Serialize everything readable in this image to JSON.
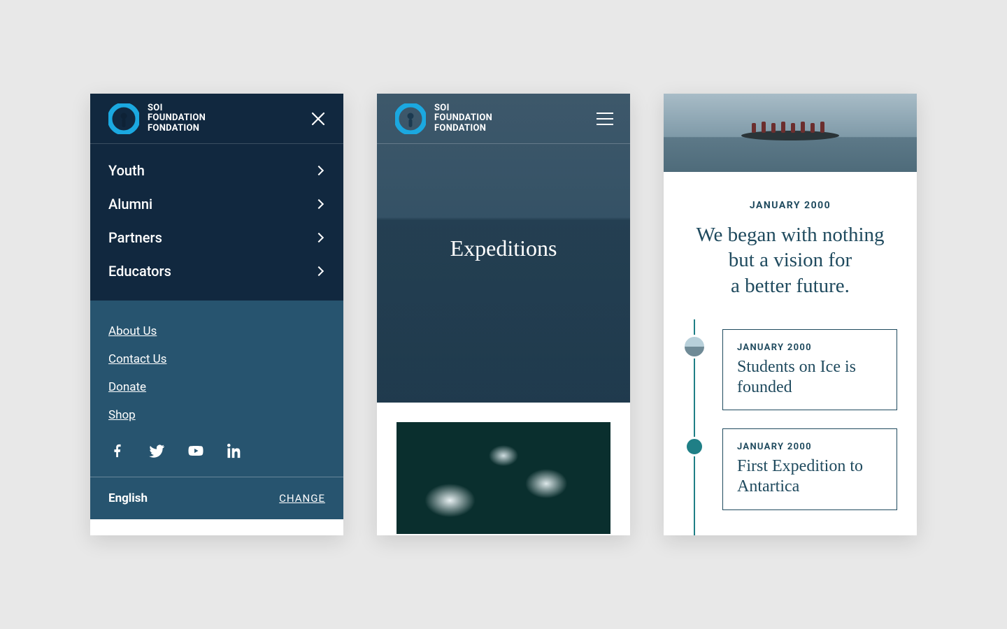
{
  "brand": {
    "line1": "SOI",
    "line2": "FOUNDATION",
    "line3": "FONDATION",
    "accent": "#1ba8e0"
  },
  "menu": {
    "primary": [
      "Youth",
      "Alumni",
      "Partners",
      "Educators"
    ],
    "secondary": [
      "About Us",
      "Contact Us",
      "Donate",
      "Shop"
    ],
    "social": [
      "facebook",
      "twitter",
      "youtube",
      "linkedin"
    ],
    "lang_current": "English",
    "lang_change": "CHANGE"
  },
  "hero": {
    "title": "Expeditions"
  },
  "timeline": {
    "eyebrow": "JANUARY 2000",
    "headline": "We began with nothing but a vision for a better future.",
    "items": [
      {
        "date": "JANUARY 2000",
        "title": "Students on Ice is founded",
        "has_thumb": true
      },
      {
        "date": "JANUARY 2000",
        "title": "First Expedition to Antartica",
        "has_thumb": false
      }
    ]
  }
}
